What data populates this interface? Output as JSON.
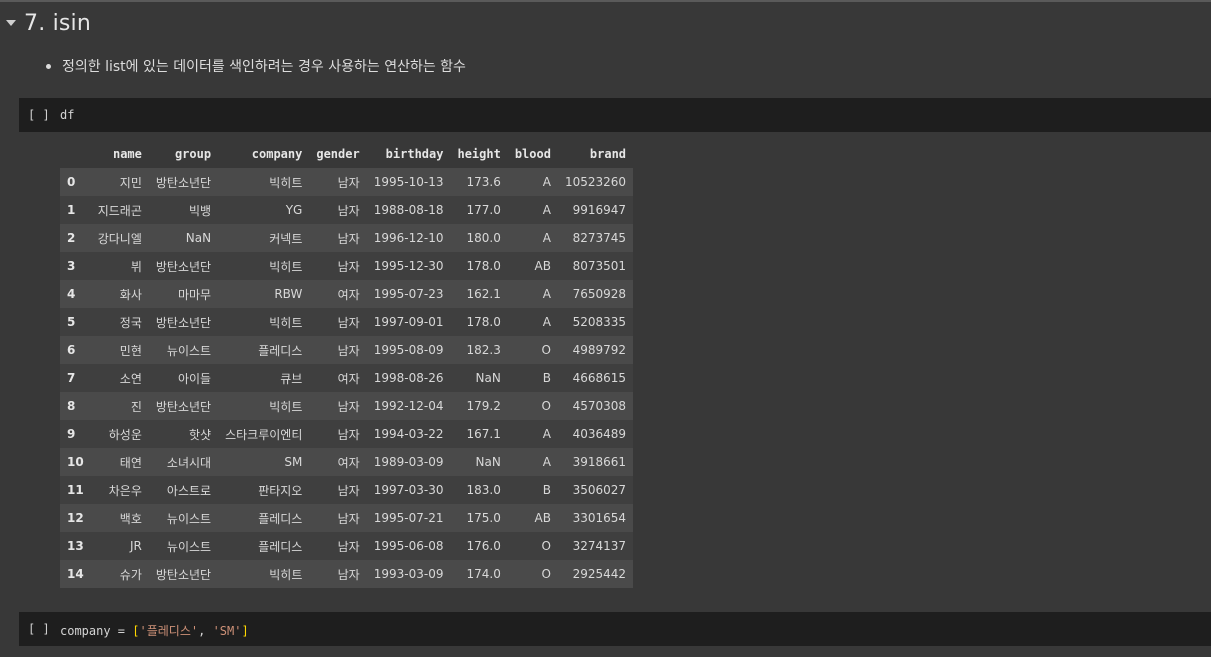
{
  "section": {
    "title": "7. isin"
  },
  "bullet": {
    "text": "정의한 list에 있는 데이터를 색인하려는 경우 사용하는 연산하는 함수"
  },
  "cells": [
    {
      "run_label": "[ ]",
      "code": "df"
    },
    {
      "run_label": "[ ]",
      "code_var": "company",
      "code_eq": " = ",
      "code_open": "[",
      "code_s1": "'플레디스'",
      "code_comma": ", ",
      "code_s2": "'SM'",
      "code_close": "]"
    }
  ],
  "table": {
    "columns": [
      "name",
      "group",
      "company",
      "gender",
      "birthday",
      "height",
      "blood",
      "brand"
    ],
    "rows": [
      [
        "0",
        "지민",
        "방탄소년단",
        "빅히트",
        "남자",
        "1995-10-13",
        "173.6",
        "A",
        "10523260"
      ],
      [
        "1",
        "지드래곤",
        "빅뱅",
        "YG",
        "남자",
        "1988-08-18",
        "177.0",
        "A",
        "9916947"
      ],
      [
        "2",
        "강다니엘",
        "NaN",
        "커넥트",
        "남자",
        "1996-12-10",
        "180.0",
        "A",
        "8273745"
      ],
      [
        "3",
        "뷔",
        "방탄소년단",
        "빅히트",
        "남자",
        "1995-12-30",
        "178.0",
        "AB",
        "8073501"
      ],
      [
        "4",
        "화사",
        "마마무",
        "RBW",
        "여자",
        "1995-07-23",
        "162.1",
        "A",
        "7650928"
      ],
      [
        "5",
        "정국",
        "방탄소년단",
        "빅히트",
        "남자",
        "1997-09-01",
        "178.0",
        "A",
        "5208335"
      ],
      [
        "6",
        "민현",
        "뉴이스트",
        "플레디스",
        "남자",
        "1995-08-09",
        "182.3",
        "O",
        "4989792"
      ],
      [
        "7",
        "소연",
        "아이들",
        "큐브",
        "여자",
        "1998-08-26",
        "NaN",
        "B",
        "4668615"
      ],
      [
        "8",
        "진",
        "방탄소년단",
        "빅히트",
        "남자",
        "1992-12-04",
        "179.2",
        "O",
        "4570308"
      ],
      [
        "9",
        "하성운",
        "핫샷",
        "스타크루이엔티",
        "남자",
        "1994-03-22",
        "167.1",
        "A",
        "4036489"
      ],
      [
        "10",
        "태연",
        "소녀시대",
        "SM",
        "여자",
        "1989-03-09",
        "NaN",
        "A",
        "3918661"
      ],
      [
        "11",
        "차은우",
        "아스트로",
        "판타지오",
        "남자",
        "1997-03-30",
        "183.0",
        "B",
        "3506027"
      ],
      [
        "12",
        "백호",
        "뉴이스트",
        "플레디스",
        "남자",
        "1995-07-21",
        "175.0",
        "AB",
        "3301654"
      ],
      [
        "13",
        "JR",
        "뉴이스트",
        "플레디스",
        "남자",
        "1995-06-08",
        "176.0",
        "O",
        "3274137"
      ],
      [
        "14",
        "슈가",
        "방탄소년단",
        "빅히트",
        "남자",
        "1993-03-09",
        "174.0",
        "O",
        "2925442"
      ]
    ]
  }
}
